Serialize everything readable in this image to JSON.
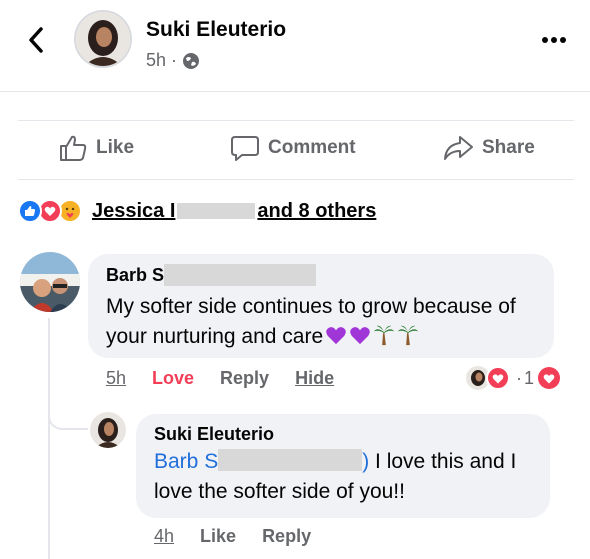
{
  "post": {
    "author": "Suki Eleuterio",
    "time": "5h",
    "separator": "·",
    "privacy_icon": "globe-icon"
  },
  "actions": {
    "like": "Like",
    "comment": "Comment",
    "share": "Share"
  },
  "reactions": {
    "icons": [
      "like-icon",
      "love-icon",
      "care-icon"
    ],
    "name_start": "Jessica I",
    "name_end": "and 8 others"
  },
  "comments": [
    {
      "author": "Barb S",
      "text": "My softer side continues to grow because of your nurturing and care",
      "emojis": [
        "purple-heart",
        "purple-heart",
        "palm-tree",
        "palm-tree"
      ],
      "time": "5h",
      "love": "Love",
      "reply": "Reply",
      "hide": "Hide",
      "reaction_count": "1",
      "dot": "·"
    },
    {
      "author": "Suki Eleuterio",
      "mention_start": "Barb S",
      "text_tail": "I love this and I",
      "text_line2": "love the softer side of you!!",
      "time": "4h",
      "like": "Like",
      "reply": "Reply"
    }
  ],
  "colors": {
    "like_blue": "#1877f2",
    "love_red": "#f33e58",
    "mention_blue": "#216fdb",
    "bubble_bg": "#f0f2f5",
    "muted_text": "#65676b",
    "purple_heart": "#a035d8",
    "palm_green": "#2e7d32"
  }
}
